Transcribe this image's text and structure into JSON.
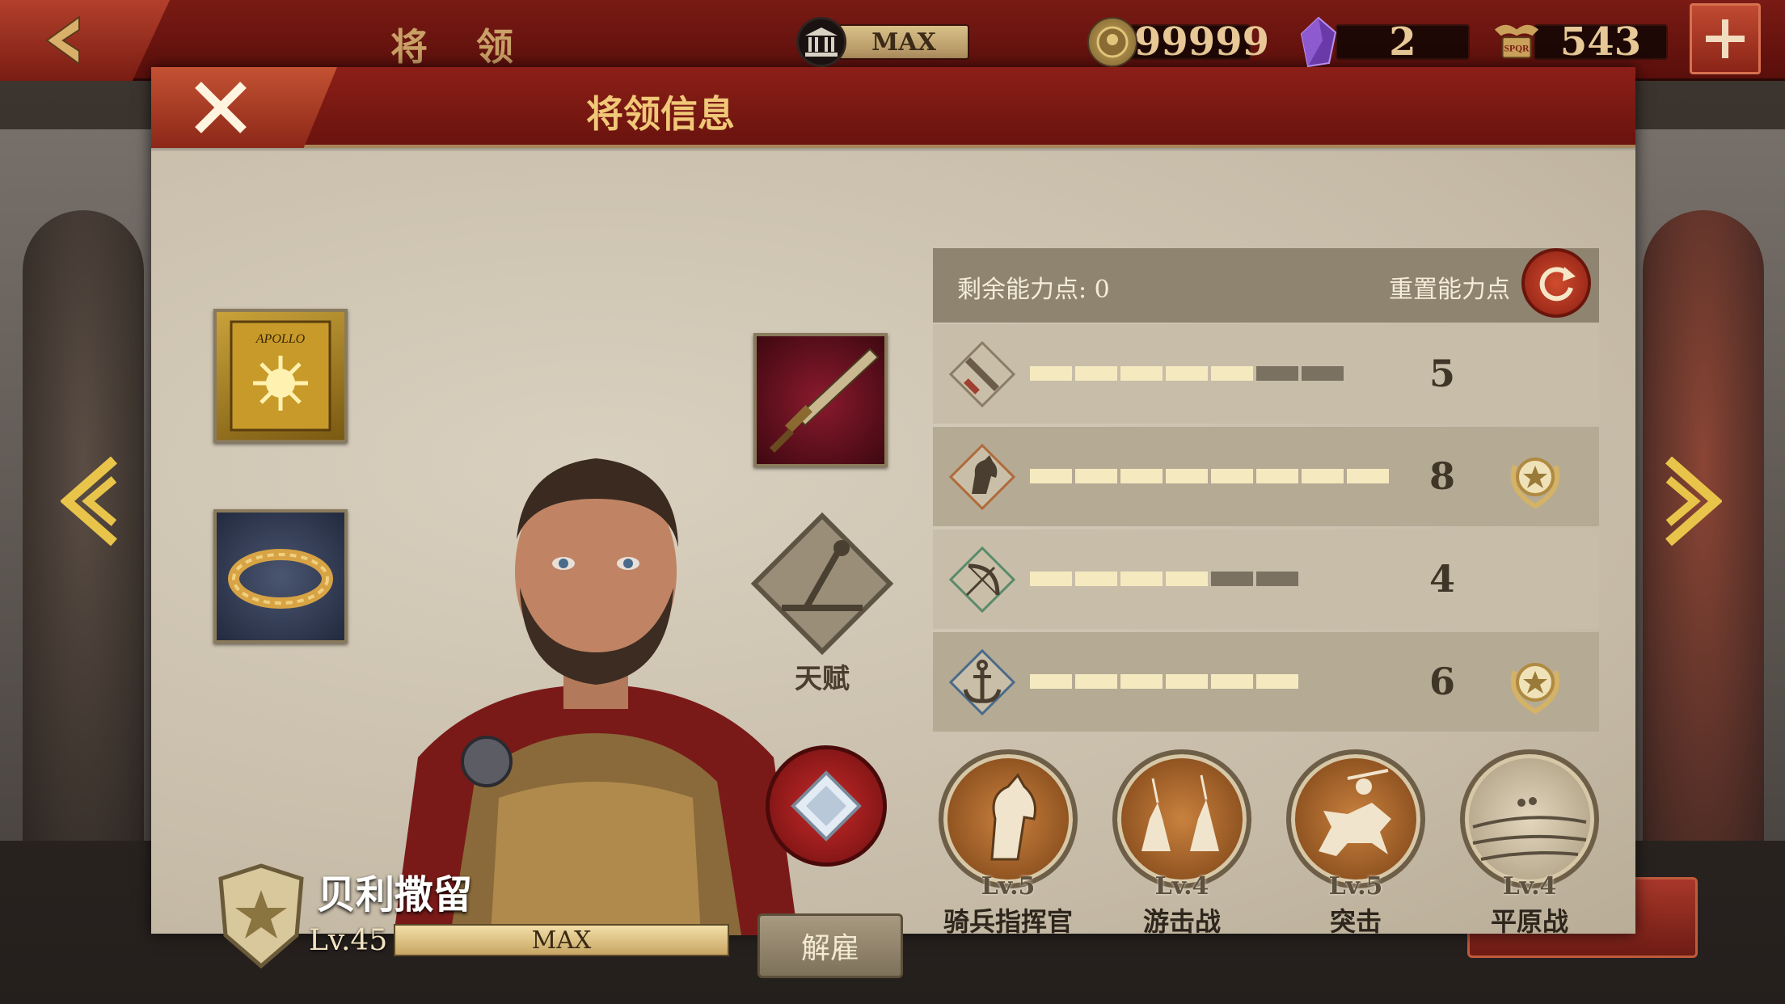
{
  "topbar": {
    "back_icon": "back-arrow-icon",
    "title": "将 领",
    "resources": {
      "building": {
        "icon": "building-icon",
        "value": "MAX"
      },
      "coins": {
        "icon": "coin-icon",
        "value": "99999"
      },
      "gems": {
        "icon": "gem-icon",
        "value": "2"
      },
      "spqr": {
        "icon": "spqr-eagle-icon",
        "value": "543"
      }
    },
    "plus_icon": "plus-icon"
  },
  "panel": {
    "title": "将领信息",
    "close_icon": "close-icon"
  },
  "equipment": [
    {
      "name": "banner",
      "icon": "apollo-banner-icon",
      "text": "APOLLO"
    },
    {
      "name": "wreath",
      "icon": "laurel-wreath-icon"
    },
    {
      "name": "weapon",
      "icon": "dagger-icon"
    }
  ],
  "talent": {
    "label": "天赋",
    "icon": "catapult-icon"
  },
  "gem_slot": {
    "icon": "diamond-icon"
  },
  "hero": {
    "name": "贝利撒留",
    "level": "Lv.45",
    "xp_text": "MAX",
    "xp_progress": 1.0,
    "fire_label": "解雇"
  },
  "stats": {
    "remaining_label": "剩余能力点: 0",
    "reset_label": "重置能力点",
    "rows": [
      {
        "name": "infantry",
        "icon": "sword-icon",
        "value": "5",
        "filled": 5,
        "total": 7,
        "badge": false
      },
      {
        "name": "cavalry",
        "icon": "horse-icon",
        "value": "8",
        "filled": 8,
        "total": 8,
        "badge": true
      },
      {
        "name": "archery",
        "icon": "bow-icon",
        "value": "4",
        "filled": 4,
        "total": 6,
        "badge": false
      },
      {
        "name": "navy",
        "icon": "anchor-icon",
        "value": "6",
        "filled": 6,
        "total": 6,
        "badge": true
      }
    ]
  },
  "skills": [
    {
      "level": "Lv.5",
      "name": "骑兵指挥官",
      "icon": "horse-head-icon",
      "style": "bronze"
    },
    {
      "level": "Lv.4",
      "name": "游击战",
      "icon": "skirmish-icon",
      "style": "bronze"
    },
    {
      "level": "Lv.5",
      "name": "突击",
      "icon": "charge-icon",
      "style": "bronze"
    },
    {
      "level": "Lv.4",
      "name": "平原战",
      "icon": "plains-icon",
      "style": "sand"
    }
  ],
  "colors": {
    "header_red": "#7a1a14",
    "panel_bg": "#cfc5b3",
    "gold_text": "#f0c878",
    "bar_on": "#f5e9bf",
    "bar_off": "#7a7160"
  }
}
